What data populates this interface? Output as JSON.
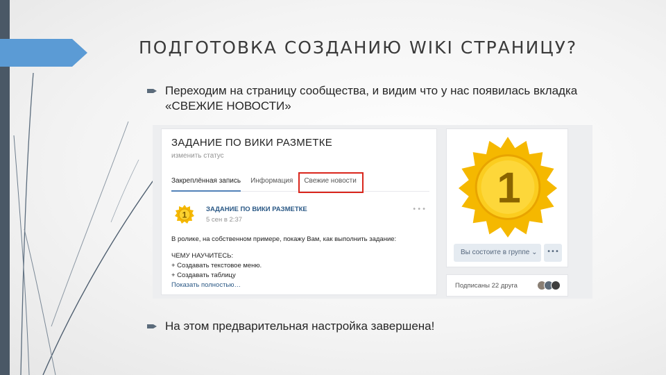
{
  "slide": {
    "title": "ПОДГОТОВКА СОЗДАНИЮ WIKI СТРАНИЦУ?",
    "bullets": [
      "Переходим на страницу сообщества, и видим что у нас появилась вкладка «СВЕЖИЕ НОВОСТИ»",
      "На этом предварительная настройка завершена!"
    ]
  },
  "screenshot": {
    "group_title": "ЗАДАНИЕ ПО ВИКИ РАЗМЕТКЕ",
    "status_link": "изменить статус",
    "tabs": [
      "Закреплённая запись",
      "Информация",
      "Свежие новости"
    ],
    "post": {
      "author": "ЗАДАНИЕ ПО ВИКИ РАЗМЕТКЕ",
      "time": "5 сен в 2:37",
      "more": "•••",
      "line1": "В ролике, на собственном примере, покажу Вам, как выполнить задание:",
      "line2": "ЧЕМУ НАУЧИТЕСЬ:",
      "line3": "+ Создавать текстовое меню.",
      "line4": "+ Создавать таблицу",
      "show_more": "Показать полностью…"
    },
    "medal_number": "1",
    "member_button": "Вы состоите в группе ⌄",
    "more_button": "•••",
    "friends_text": "Подписаны 22 друга"
  },
  "colors": {
    "accent": "#5b9bd5",
    "highlight_border": "#d9261c",
    "link": "#2a5885",
    "medal": "#f5b800"
  }
}
